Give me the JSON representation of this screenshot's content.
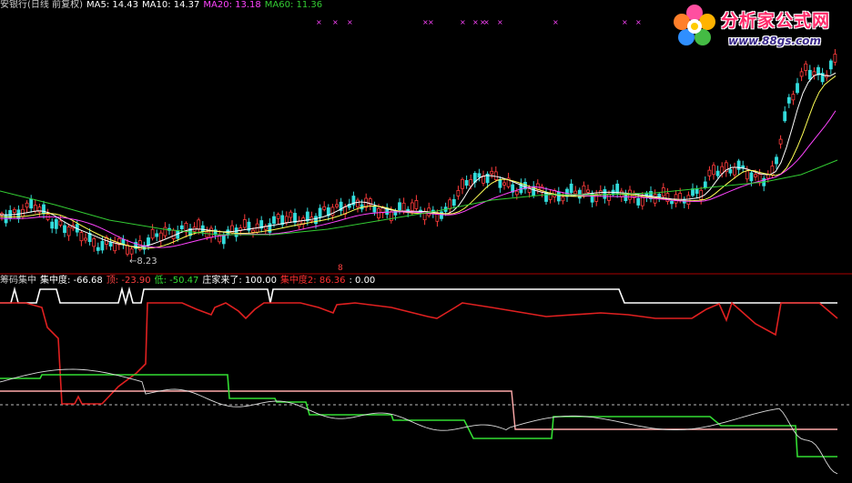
{
  "top_legend": [
    {
      "text": "安银行(日线 前复权)",
      "color": "#cfcfcf"
    },
    {
      "text": "MA5: 14.43",
      "color": "#ffffff"
    },
    {
      "text": "MA10: 14.37",
      "color": "#ffffff"
    },
    {
      "text": "MA20: 13.18",
      "color": "#ff44ff"
    },
    {
      "text": "MA60: 11.36",
      "color": "#33cc33"
    }
  ],
  "bottom_legend": [
    {
      "text": "筹码集中",
      "color": "#cfcfcf"
    },
    {
      "text": "集中度: -66.68",
      "color": "#ffffff"
    },
    {
      "text": "顶: -23.90",
      "color": "#ff4040"
    },
    {
      "text": "低: -50.47",
      "color": "#33dd33"
    },
    {
      "text": "庄家来了: 100.00",
      "color": "#ffffff"
    },
    {
      "text": "集中度2: 86.36",
      "color": "#ff3030"
    },
    {
      "text": ": 0.00",
      "color": "#ffffff"
    }
  ],
  "low_price_label": "←8.23",
  "marker_label": "8",
  "logo": {
    "title": "分析家公式网",
    "url": "www.88gs.com"
  },
  "colors": {
    "up": "#ff3b3b",
    "down": "#33dddd",
    "ma5": "#ffffff",
    "ma10": "#ffff55",
    "ma20": "#ff44ff",
    "ma60": "#33cc33",
    "divider": "#aa0000",
    "concentration": "#e02020",
    "banker": "#ffffff",
    "top_line": "#ffaaaa",
    "low_line": "#33dd33",
    "fine_line": "#dddddd"
  }
}
